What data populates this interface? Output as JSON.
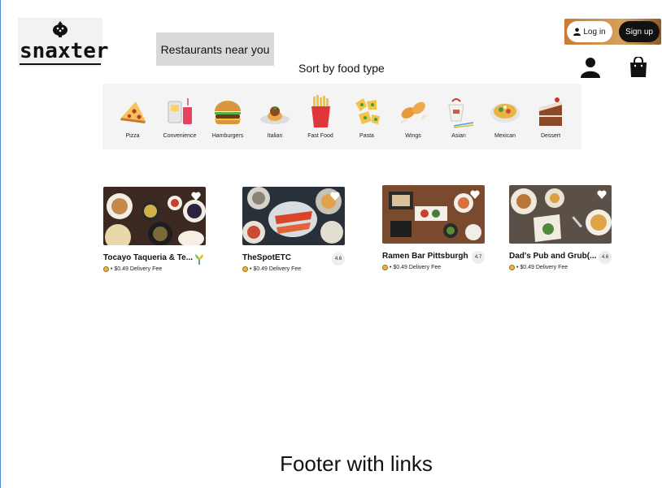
{
  "brand": {
    "logo_text": "snaxter"
  },
  "header": {
    "near_button": "Restaurants near you",
    "login_label": "Log in",
    "signup_label": "Sign up"
  },
  "sort": {
    "title": "Sort by food type",
    "categories": [
      {
        "label": "Pizza",
        "icon": "pizza-icon"
      },
      {
        "label": "Convenience",
        "icon": "convenience-icon"
      },
      {
        "label": "Hamburgers",
        "icon": "burger-icon"
      },
      {
        "label": "Italian",
        "icon": "italian-icon"
      },
      {
        "label": "Fast Food",
        "icon": "fries-icon"
      },
      {
        "label": "Pasta",
        "icon": "pasta-icon"
      },
      {
        "label": "Wings",
        "icon": "wings-icon"
      },
      {
        "label": "Asian",
        "icon": "takeout-icon"
      },
      {
        "label": "Mexican",
        "icon": "nachos-icon"
      },
      {
        "label": "Dessert",
        "icon": "cake-icon"
      }
    ]
  },
  "restaurants": [
    {
      "name": "Tocayo Taqueria & Te...",
      "fee": "• $0.49 Delivery Fee",
      "rating": ""
    },
    {
      "name": "TheSpotETC",
      "fee": "• $0.49 Delivery Fee",
      "rating": "4.6"
    },
    {
      "name": "Ramen Bar Pittsburgh",
      "fee": "• $0.49 Delivery Fee",
      "rating": "4.7"
    },
    {
      "name": "Dad's Pub and Grub(...",
      "fee": "• $0.49 Delivery Fee",
      "rating": "4.6"
    }
  ],
  "footer": {
    "text": "Footer with links"
  }
}
